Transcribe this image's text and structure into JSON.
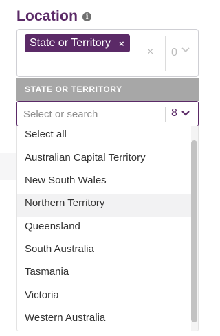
{
  "field": {
    "title": "Location",
    "info_icon": "info-icon",
    "info_glyph": "i"
  },
  "selected": {
    "chips": [
      {
        "label": "State or Territory",
        "remove_glyph": "×"
      }
    ],
    "clear_glyph": "×",
    "count": "0"
  },
  "group": {
    "header": "STATE OR TERRITORY"
  },
  "search": {
    "placeholder": "Select or search",
    "value": "",
    "count": "8"
  },
  "options": [
    {
      "label": "Select all",
      "highlighted": false
    },
    {
      "label": "Australian Capital Territory",
      "highlighted": false
    },
    {
      "label": "New South Wales",
      "highlighted": false
    },
    {
      "label": "Northern Territory",
      "highlighted": true
    },
    {
      "label": "Queensland",
      "highlighted": false
    },
    {
      "label": "South Australia",
      "highlighted": false
    },
    {
      "label": "Tasmania",
      "highlighted": false
    },
    {
      "label": "Victoria",
      "highlighted": false
    },
    {
      "label": "Western Australia",
      "highlighted": false
    }
  ],
  "colors": {
    "brand": "#5b2a67",
    "header_bg": "#a7a7a7",
    "highlight_bg": "#f2f2f3"
  }
}
